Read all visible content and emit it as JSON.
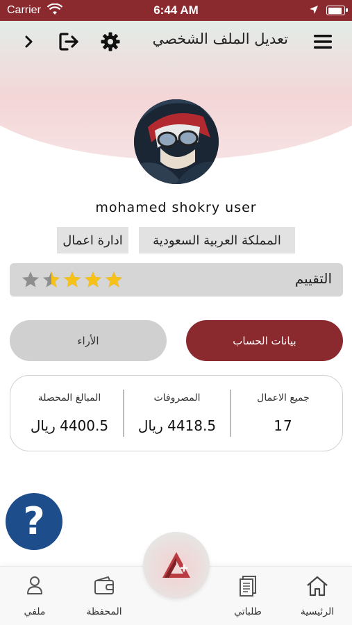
{
  "status_bar": {
    "carrier": "Carrier",
    "time": "6:44 AM",
    "battery_level": 0.95
  },
  "header": {
    "title": "تعديل الملف الشخصي",
    "icons": [
      "chevron-right-icon",
      "logout-icon",
      "gear-icon",
      "hamburger-menu-icon"
    ]
  },
  "profile": {
    "username": "mohamed shokry user",
    "country": "المملكة العربية السعودية",
    "job": "ادارة اعمال"
  },
  "rating": {
    "label": "التقييم",
    "value": 3.5,
    "max": 5
  },
  "tabs": {
    "account": "بيانات الحساب",
    "reviews": "الأراء"
  },
  "stats": {
    "jobs_label": "جميع الاعمال",
    "jobs_value": "17",
    "expenses_label": "المصروفات",
    "expenses_value": "4418.5 ريال",
    "collected_label": "المبالغ المحصلة",
    "collected_value": "4400.5 ريال"
  },
  "help": {
    "symbol": "?"
  },
  "bottom_nav": {
    "home": "الرئيسية",
    "orders": "طلباتي",
    "wallet": "المحفظة",
    "profile": "ملفي"
  },
  "colors": {
    "primary": "#8b2a2e",
    "star": "#f6c21a",
    "star_empty": "#8e8e8e",
    "help_blue": "#1e4d8c"
  }
}
